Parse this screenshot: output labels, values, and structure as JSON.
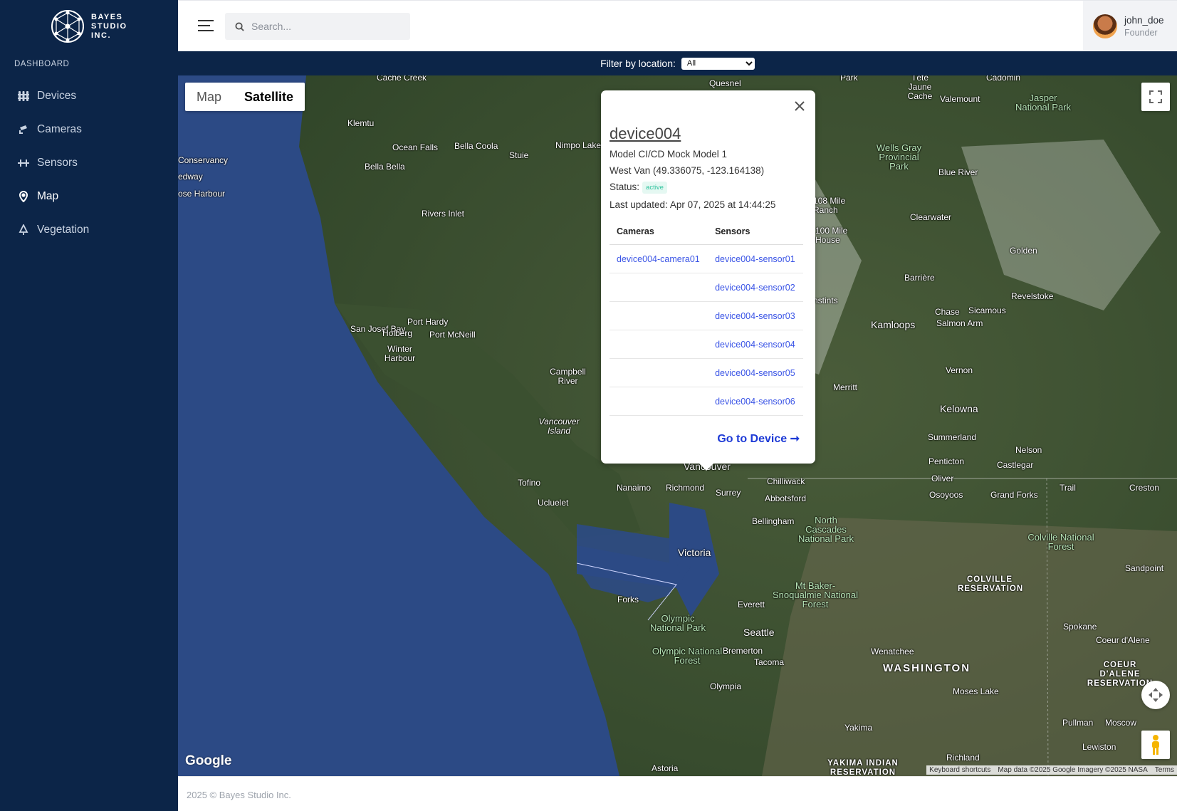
{
  "brand": {
    "logo_text": "BAYES\nSTUDIO\nINC."
  },
  "sidebar": {
    "section_title": "DASHBOARD",
    "items": [
      {
        "label": "Devices",
        "icon": "devices-icon"
      },
      {
        "label": "Cameras",
        "icon": "camera-icon"
      },
      {
        "label": "Sensors",
        "icon": "sensor-icon"
      },
      {
        "label": "Map",
        "icon": "map-pin-icon",
        "active": true
      },
      {
        "label": "Vegetation",
        "icon": "tree-icon"
      }
    ]
  },
  "header": {
    "search_placeholder": "Search...",
    "user": {
      "name": "john_doe",
      "role": "Founder"
    }
  },
  "filter": {
    "label": "Filter by location:",
    "selected": "All"
  },
  "map": {
    "types": [
      "Map",
      "Satellite"
    ],
    "selected_type": "Satellite",
    "google": "Google",
    "attribution": [
      "Keyboard shortcuts",
      "Map data ©2025 Google Imagery ©2025 NASA",
      "Terms"
    ],
    "labels": [
      "Quesnel",
      "Park",
      "Tête Jaune Cache",
      "Cadomin",
      "Valemount",
      "Jasper National Park",
      "Klemtu",
      "Ocean Falls",
      "Bella Coola",
      "Stuie",
      "Nimpo Lake",
      "Bella Bella",
      "Wells Gray Provincial Park",
      "Blue River",
      "Rivers Inlet",
      "108 Mile Ranch",
      "100 Mile House",
      "Clearwater",
      "Golden",
      "Barrière",
      "Revelstoke",
      "San Josef Bay",
      "Port Hardy",
      "Holberg",
      "Port McNeill",
      "Winter Harbour",
      "Kamloops",
      "Chase",
      "Sicamous",
      "Salmon Arm",
      "Campbell River",
      "Vernon",
      "Merritt",
      "Kelowna",
      "Vancouver Island",
      "Summerland",
      "Penticton",
      "Nelson",
      "Oliver",
      "Castlegar",
      "Tofino",
      "Ucluelet",
      "Nanaimo",
      "Richmond",
      "Surrey",
      "Chilliwack",
      "Abbotsford",
      "Vancouver",
      "Osoyoos",
      "Grand Forks",
      "Trail",
      "Creston",
      "Bellingham",
      "North Cascades National Park",
      "Colville National Forest",
      "Victoria",
      "Sandpoint",
      "Forks",
      "Everett",
      "Mt Baker-Snoqualmie National Forest",
      "COLVILLE RESERVATION",
      "Olympic National Park",
      "Seattle",
      "Spokane",
      "Coeur d'Alene",
      "Bremerton",
      "Olympic National Forest",
      "Tacoma",
      "Wenatchee",
      "WASHINGTON",
      "COEUR D'ALENE RESERVATION",
      "Olympia",
      "Moses Lake",
      "Yakima",
      "Pullman",
      "Moscow",
      "Lewiston",
      "Richland",
      "YAKIMA INDIAN RESERVATION",
      "Astoria",
      "Conservancy",
      "edway",
      "ose Harbour",
      "nstints",
      "Cache Creek"
    ]
  },
  "popup": {
    "device": "device004",
    "model": "Model CI/CD Mock Model 1",
    "location": "West Van (49.336075, -123.164138)",
    "status_label": "Status:",
    "status": "active",
    "updated": "Last updated: Apr 07, 2025 at 14:44:25",
    "col_cameras": "Cameras",
    "col_sensors": "Sensors",
    "rows": [
      {
        "camera": "device004-camera01",
        "sensor": "device004-sensor01"
      },
      {
        "camera": "",
        "sensor": "device004-sensor02"
      },
      {
        "camera": "",
        "sensor": "device004-sensor03"
      },
      {
        "camera": "",
        "sensor": "device004-sensor04"
      },
      {
        "camera": "",
        "sensor": "device004-sensor05"
      },
      {
        "camera": "",
        "sensor": "device004-sensor06"
      }
    ],
    "goto": "Go to Device ➞"
  },
  "footer": {
    "text": "2025 © Bayes Studio Inc."
  },
  "colors": {
    "sidebar": "#0c2548",
    "link": "#3b55e6",
    "active_badge": "#30c39e"
  }
}
